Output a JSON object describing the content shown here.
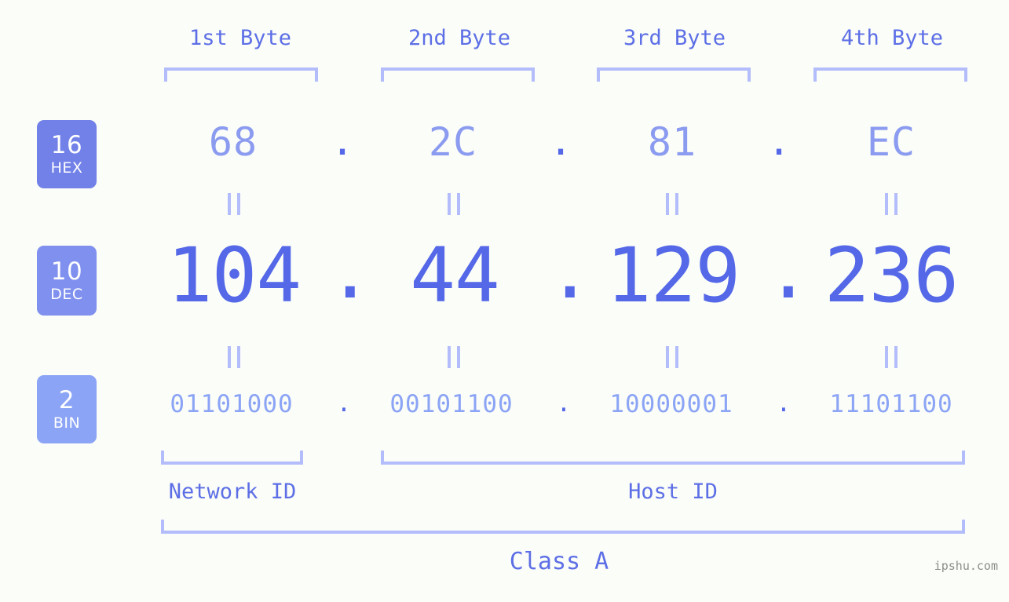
{
  "watermark": "ipshu.com",
  "byte_headers": [
    {
      "label": "1st Byte"
    },
    {
      "label": "2nd Byte"
    },
    {
      "label": "3rd Byte"
    },
    {
      "label": "4th Byte"
    }
  ],
  "bases": [
    {
      "radix": "16",
      "name": "HEX",
      "color": "#7181e8"
    },
    {
      "radix": "10",
      "name": "DEC",
      "color": "#8090ef"
    },
    {
      "radix": "2",
      "name": "BIN",
      "color": "#8ba4f5"
    }
  ],
  "rows": {
    "hex": {
      "values": [
        "68",
        "2C",
        "81",
        "EC"
      ],
      "separator": "."
    },
    "dec": {
      "values": [
        "104",
        "44",
        "129",
        "236"
      ],
      "separator": "."
    },
    "bin": {
      "values": [
        "01101000",
        "00101100",
        "10000001",
        "11101100"
      ],
      "separator": "."
    }
  },
  "equals_symbol": "=",
  "sections": [
    {
      "label": "Network ID"
    },
    {
      "label": "Host ID"
    }
  ],
  "ip_class": {
    "label": "Class A"
  },
  "colors": {
    "background": "#fbfdf8",
    "bracket": "#b3bdfb",
    "header_text": "#5d6fe6",
    "hex_text": "#8b9bf0",
    "dec_text": "#5468e8",
    "bin_text": "#8ba4f5",
    "dot": "#5468e8",
    "watermark_text": "#8a8f8a"
  },
  "chart_data": {
    "type": "table",
    "title": "IPv4 Address Representation 104.44.129.236",
    "columns": [
      "1st Byte",
      "2nd Byte",
      "3rd Byte",
      "4th Byte"
    ],
    "rows": [
      {
        "base": "HEX",
        "radix": 16,
        "values": [
          "68",
          "2C",
          "81",
          "EC"
        ]
      },
      {
        "base": "DEC",
        "radix": 10,
        "values": [
          "104",
          "44",
          "129",
          "236"
        ]
      },
      {
        "base": "BIN",
        "radix": 2,
        "values": [
          "01101000",
          "00101100",
          "10000001",
          "11101100"
        ]
      }
    ],
    "network_id_bytes": [
      1
    ],
    "host_id_bytes": [
      2,
      3,
      4
    ],
    "ip_class": "Class A"
  }
}
